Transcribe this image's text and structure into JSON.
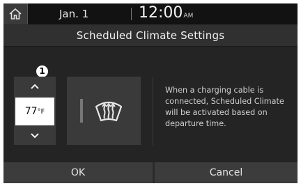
{
  "status_bar": {
    "home_icon": "home-icon",
    "date": "Jan.  1",
    "time": "12:00",
    "ampm": "AM"
  },
  "title": "Scheduled Climate Settings",
  "callout_number": "1",
  "temperature": {
    "value": "77",
    "unit": "°F",
    "up_icon": "chevron-up-icon",
    "down_icon": "chevron-down-icon"
  },
  "defrost": {
    "icon": "front-defrost-icon",
    "active": false
  },
  "description": "When a charging cable is connected, Scheduled Climate will be activated based on departure time.",
  "buttons": {
    "ok": "OK",
    "cancel": "Cancel"
  },
  "colors": {
    "background": "#242424",
    "status_bar": "#121212",
    "button": "#3c3c3c",
    "text": "#e6e6e6"
  }
}
